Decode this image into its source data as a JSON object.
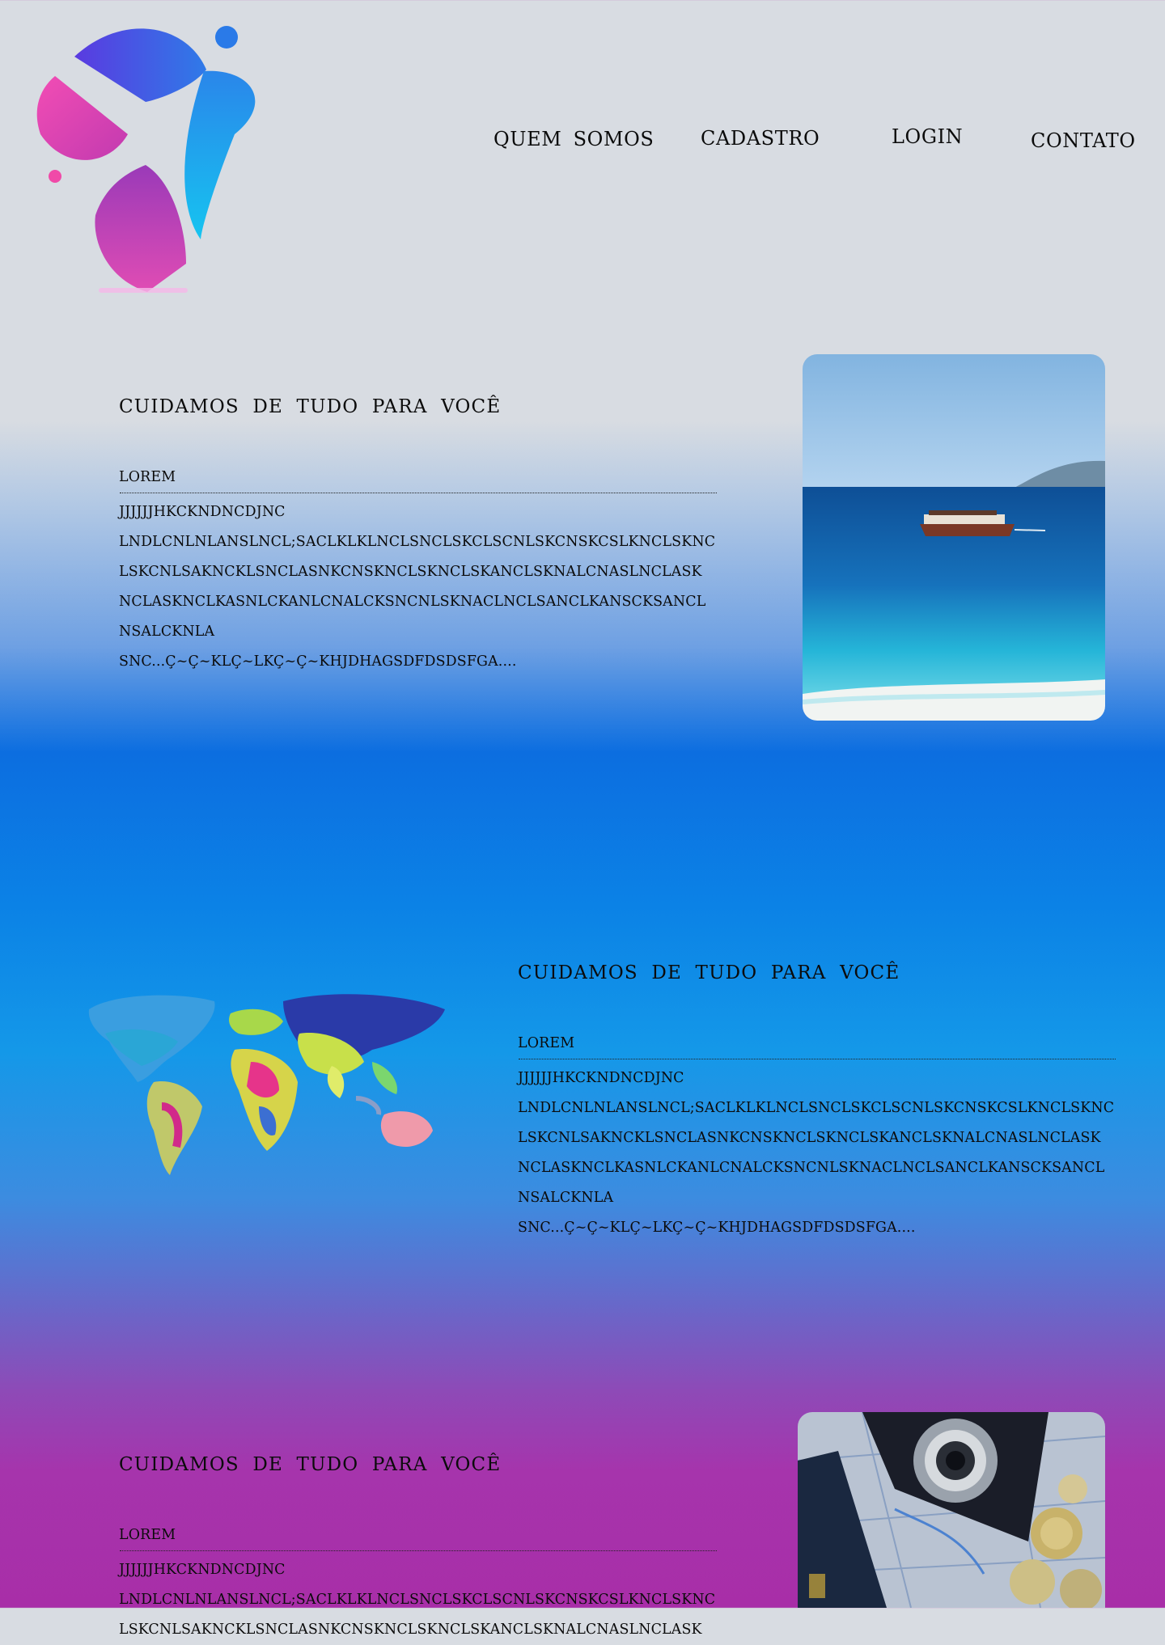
{
  "nav": {
    "items": [
      {
        "label": "QUEM  SOMOS"
      },
      {
        "label": "CADASTRO"
      },
      {
        "label": "LOGIN"
      },
      {
        "label": "CONTATO"
      }
    ]
  },
  "sections": [
    {
      "heading": "CUIDAMOS  DE  TUDO  PARA  VOCÊ",
      "line1_start": "LOREM",
      "line1_end": "JJJJJJHKCKNDNCDJNC",
      "line2": "LNDLCNLNLANSLNCL;SACLKLKLNCLSNCLSKCLSCNLSKCNSKCSLKNCLSKNC",
      "line3": "LSKCNLSAKNCKLSNCLASNKCNSKNCLSKNCLSKANCLSKNALCNASLNCLASK",
      "line4": "NCLASKNCLKASNLCKANLCNALCKSNCNLSKNACLNCLSANCLKANSCKSANCL",
      "line5": "NSALCKNLA",
      "line6": "SNC...Ç~Ç~KLÇ~LKÇ~Ç~KHJDHAGSDFDSDSFGA....",
      "image": "sea-boat-photo"
    },
    {
      "heading": "CUIDAMOS  DE  TUDO  PARA  VOCÊ",
      "line1_start": "LOREM",
      "line1_end": "JJJJJJHKCKNDNCDJNC",
      "line2": "LNDLCNLNLANSLNCL;SACLKLKLNCLSNCLSKCLSCNLSKCNSKCSLKNCLSKNC",
      "line3": "LSKCNLSAKNCKLSNCLASNKCNSKNCLSKNCLSKANCLSKNALCNASLNCLASK",
      "line4": "NCLASKNCLKASNLCKANLCNALCKSNCNLSKNACLNCLSANCLKANSCKSANCL",
      "line5": "NSALCKNLA",
      "line6": "SNC...Ç~Ç~KLÇ~LKÇ~Ç~KHJDHAGSDFDSDSFGA....",
      "image": "world-map"
    },
    {
      "heading": "CUIDAMOS  DE  TUDO  PARA  VOCÊ",
      "line1_start": "LOREM",
      "line1_end": "JJJJJJHKCKNDNCDJNC",
      "line2": "LNDLCNLNLANSLNCL;SACLKLKLNCLSNCLSKCLSCNLSKCNSKCSLKNCLSKNC",
      "line3": "LSKCNLSAKNCKLSNCLASNKCNSKNCLSKNCLSKANCLSKNALCNASLNCLASK",
      "image": "travel-camera-passport-photo"
    }
  ],
  "colors": {
    "top_background": "#d8dce2",
    "mid_blue": "#0c6ee0",
    "bottom_magenta": "#a82ea8"
  }
}
